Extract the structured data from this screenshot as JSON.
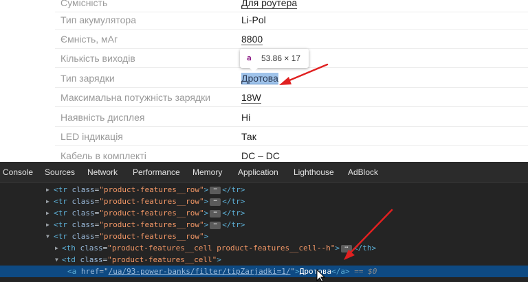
{
  "features": [
    {
      "label": "Сумісність",
      "value": "Для роутера",
      "style": "link"
    },
    {
      "label": "Тип акумулятора",
      "value": "Li-Pol",
      "style": "plain"
    },
    {
      "label": "Ємність, мАг",
      "value": "8800",
      "style": "link"
    },
    {
      "label": "Кількість виходів",
      "value": "",
      "style": "plain"
    },
    {
      "label": "Тип зарядки",
      "value": "Дротова",
      "style": "selected"
    },
    {
      "label": "Максимальна потужність зарядки",
      "value": "18W",
      "style": "link"
    },
    {
      "label": "Наявність дисплея",
      "value": "Ні",
      "style": "plain"
    },
    {
      "label": "LED індикація",
      "value": "Так",
      "style": "plain"
    },
    {
      "label": "Кабель в комплекті",
      "value": "DC – DC",
      "style": "plain"
    }
  ],
  "tooltip": {
    "tag": "a",
    "dimensions": "53.86 × 17"
  },
  "devtools": {
    "tabs": [
      "Console",
      "Sources",
      "Network",
      "Performance",
      "Memory",
      "Application",
      "Lighthouse",
      "AdBlock"
    ],
    "tree": {
      "row_open": "<tr",
      "class_attr": "class",
      "row_class": "\"product-features__row\"",
      "row_close_tail": "</tr>",
      "th_open": "<th",
      "th_class": "\"product-features__cell product-features__cell--h\"",
      "th_close_tail": "</th>",
      "td_open": "<td",
      "td_class": "\"product-features__cell\"",
      "a_open": "<a",
      "href_attr": "href",
      "href_value": "/ua/93-power-banks/filter/tipZarjadki=1/",
      "link_text": "Дротова",
      "a_close": "</a>",
      "dollar_ref": "== $0"
    }
  },
  "colors": {
    "selection": "#9fc3ea",
    "highlight_row": "#0e4a83",
    "arrow": "#e02020"
  }
}
